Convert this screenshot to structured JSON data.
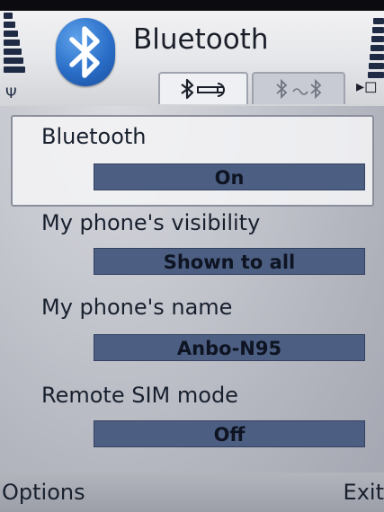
{
  "header": {
    "title": "Bluetooth",
    "tabs": [
      {
        "icon": "settings-icon",
        "active": true
      },
      {
        "icon": "paired-devices-icon",
        "active": false
      }
    ]
  },
  "settings": [
    {
      "label": "Bluetooth",
      "value": "On",
      "selected": true
    },
    {
      "label": "My phone's visibility",
      "value": "Shown to all",
      "selected": false
    },
    {
      "label": "My phone's name",
      "value": "Anbo-N95",
      "selected": false
    },
    {
      "label": "Remote SIM mode",
      "value": "Off",
      "selected": false
    }
  ],
  "softkeys": {
    "left": "Options",
    "right": "Exit"
  },
  "colors": {
    "value_field": "#4c5e82",
    "logo_blue": "#2a6ec8"
  }
}
